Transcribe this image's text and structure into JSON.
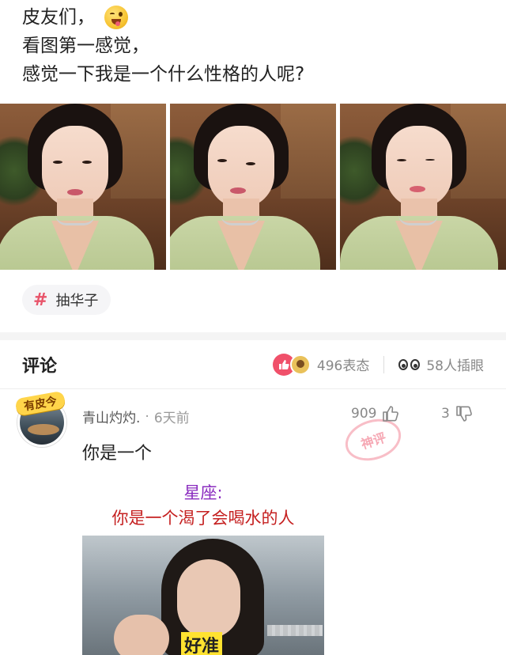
{
  "post": {
    "lines": [
      "皮友们，",
      "看图第一感觉，",
      "感觉一下我是一个什么性格的人呢?"
    ],
    "emoji": "winking-tongue-emoji"
  },
  "photos": [
    {
      "name": "photo-1"
    },
    {
      "name": "photo-2"
    },
    {
      "name": "photo-3"
    }
  ],
  "topic": {
    "hash": "#",
    "label": "抽华子"
  },
  "comments_header": {
    "title": "评论",
    "reactions": "496表态",
    "peeks": "58人插眼"
  },
  "comment": {
    "badge": "有皮今",
    "username": "青山灼灼.",
    "dot": "·",
    "time": "6天前",
    "likes": "909",
    "dislikes": "3",
    "text": "你是一个",
    "stamp": "神评",
    "meme": {
      "title": "星座:",
      "subtitle": "你是一个渴了会喝水的人",
      "caption": "好准"
    }
  },
  "colors": {
    "accent": "#f0506a",
    "text": "#222222",
    "muted": "#888888",
    "meme_title": "#8a2cbf",
    "meme_sub": "#c52020"
  }
}
